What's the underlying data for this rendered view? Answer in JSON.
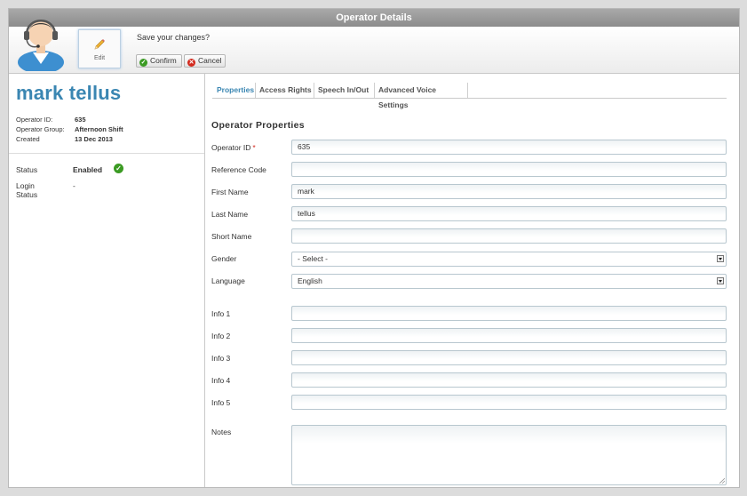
{
  "window": {
    "title": "Operator Details"
  },
  "toolbar": {
    "edit_label": "Edit",
    "save_prompt": "Save your changes?",
    "confirm_label": "Confirm",
    "cancel_label": "Cancel"
  },
  "operator": {
    "name": "mark tellus",
    "meta": [
      {
        "label": "Operator ID:",
        "value": "635"
      },
      {
        "label": "Operator Group:",
        "value": "Afternoon Shift"
      },
      {
        "label": "Created",
        "value": "13 Dec 2013"
      }
    ],
    "status_label": "Status",
    "status_value": "Enabled",
    "login_status_label": "Login Status",
    "login_status_value": "-"
  },
  "tabs": [
    {
      "label": "Properties",
      "active": true
    },
    {
      "label": "Access Rights"
    },
    {
      "label": "Speech In/Out"
    },
    {
      "label": "Advanced Voice Settings"
    }
  ],
  "form": {
    "section_title": "Operator  Properties",
    "required_mark": "*",
    "fields": [
      {
        "label": "Operator ID",
        "value": "635",
        "required": true
      },
      {
        "label": "Reference Code",
        "value": ""
      },
      {
        "label": "First Name",
        "value": "mark"
      },
      {
        "label": "Last Name",
        "value": "tellus"
      },
      {
        "label": "Short Name",
        "value": ""
      },
      {
        "label": "Gender",
        "value": "- Select -",
        "type": "select"
      },
      {
        "label": "Language",
        "value": "English",
        "type": "select"
      },
      {
        "label": "Info 1",
        "value": ""
      },
      {
        "label": "Info 2",
        "value": ""
      },
      {
        "label": "Info 3",
        "value": ""
      },
      {
        "label": "Info 4",
        "value": ""
      },
      {
        "label": "Info 5",
        "value": ""
      }
    ],
    "notes_label": "Notes",
    "notes_value": ""
  },
  "colors": {
    "accent": "#3a86b2",
    "titlebar": "#9a9a9a",
    "success": "#3b9b23",
    "danger": "#d32a1e"
  }
}
